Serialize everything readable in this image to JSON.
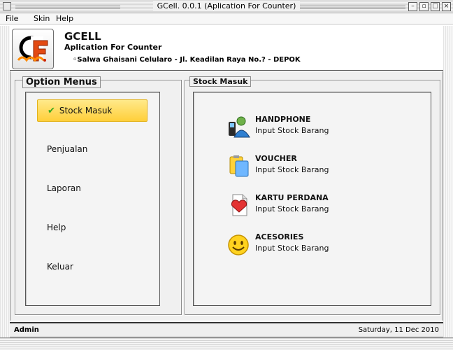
{
  "window": {
    "title": "GCell. 0.0.1 (Aplication For Counter)"
  },
  "menu": [
    "File",
    "Skin",
    "Help"
  ],
  "header": {
    "app_name": "GCELL",
    "subtitle": "Aplication For Counter",
    "address": "◦Salwa Ghaisani Celularo - Jl. Keadilan Raya No.? - DEPOK"
  },
  "option_menus": {
    "title": "Option Menus",
    "items": [
      {
        "label": "Stock Masuk",
        "active": true
      },
      {
        "label": "Penjualan",
        "active": false
      },
      {
        "label": "Laporan",
        "active": false
      },
      {
        "label": "Help",
        "active": false
      },
      {
        "label": "Keluar",
        "active": false
      }
    ]
  },
  "stock_masuk": {
    "title": "Stock Masuk",
    "items": [
      {
        "title": "HANDPHONE",
        "subtitle": "Input Stock Barang",
        "icon": "handphone-icon"
      },
      {
        "title": "VOUCHER",
        "subtitle": "Input Stock Barang",
        "icon": "voucher-icon"
      },
      {
        "title": "KARTU PERDANA",
        "subtitle": "Input Stock Barang",
        "icon": "kartu-perdana-icon"
      },
      {
        "title": "ACESORIES",
        "subtitle": "Input Stock Barang",
        "icon": "acesories-icon"
      }
    ]
  },
  "status": {
    "user": "Admin",
    "date": "Saturday, 11 Dec 2010"
  },
  "colors": {
    "active_item": "#ffd84a",
    "check": "#3aa81f"
  }
}
